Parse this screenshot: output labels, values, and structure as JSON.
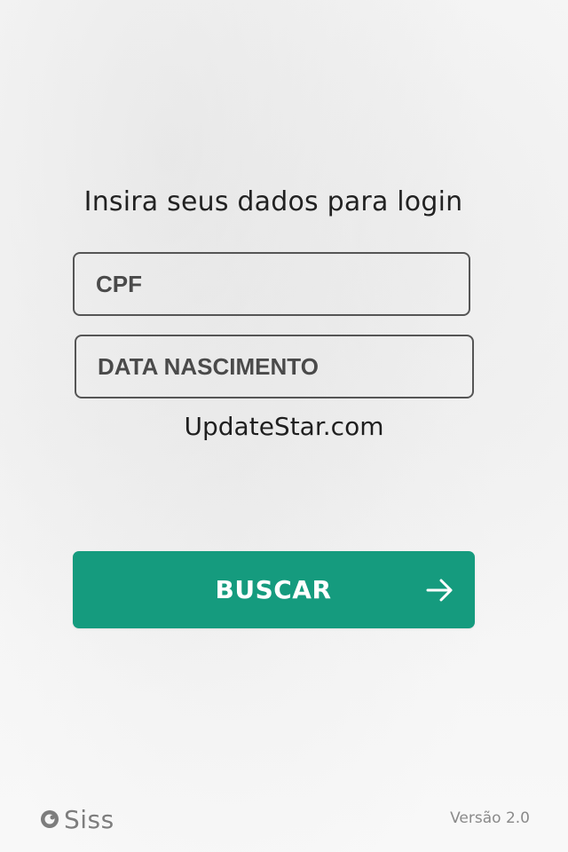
{
  "login": {
    "title": "Insira seus dados para login",
    "cpf_placeholder": "CPF",
    "birthdate_placeholder": "DATA NASCIMENTO",
    "watermark": "UpdateStar.com",
    "search_button_label": "BUSCAR",
    "search_button_icon": "arrow-right-icon"
  },
  "footer": {
    "logo_text": "Siss",
    "version": "Versão 2.0"
  },
  "colors": {
    "primary_button": "#159b7e",
    "background": "#f6f6f6",
    "text": "#222222",
    "muted_text": "#8a8a8a"
  }
}
